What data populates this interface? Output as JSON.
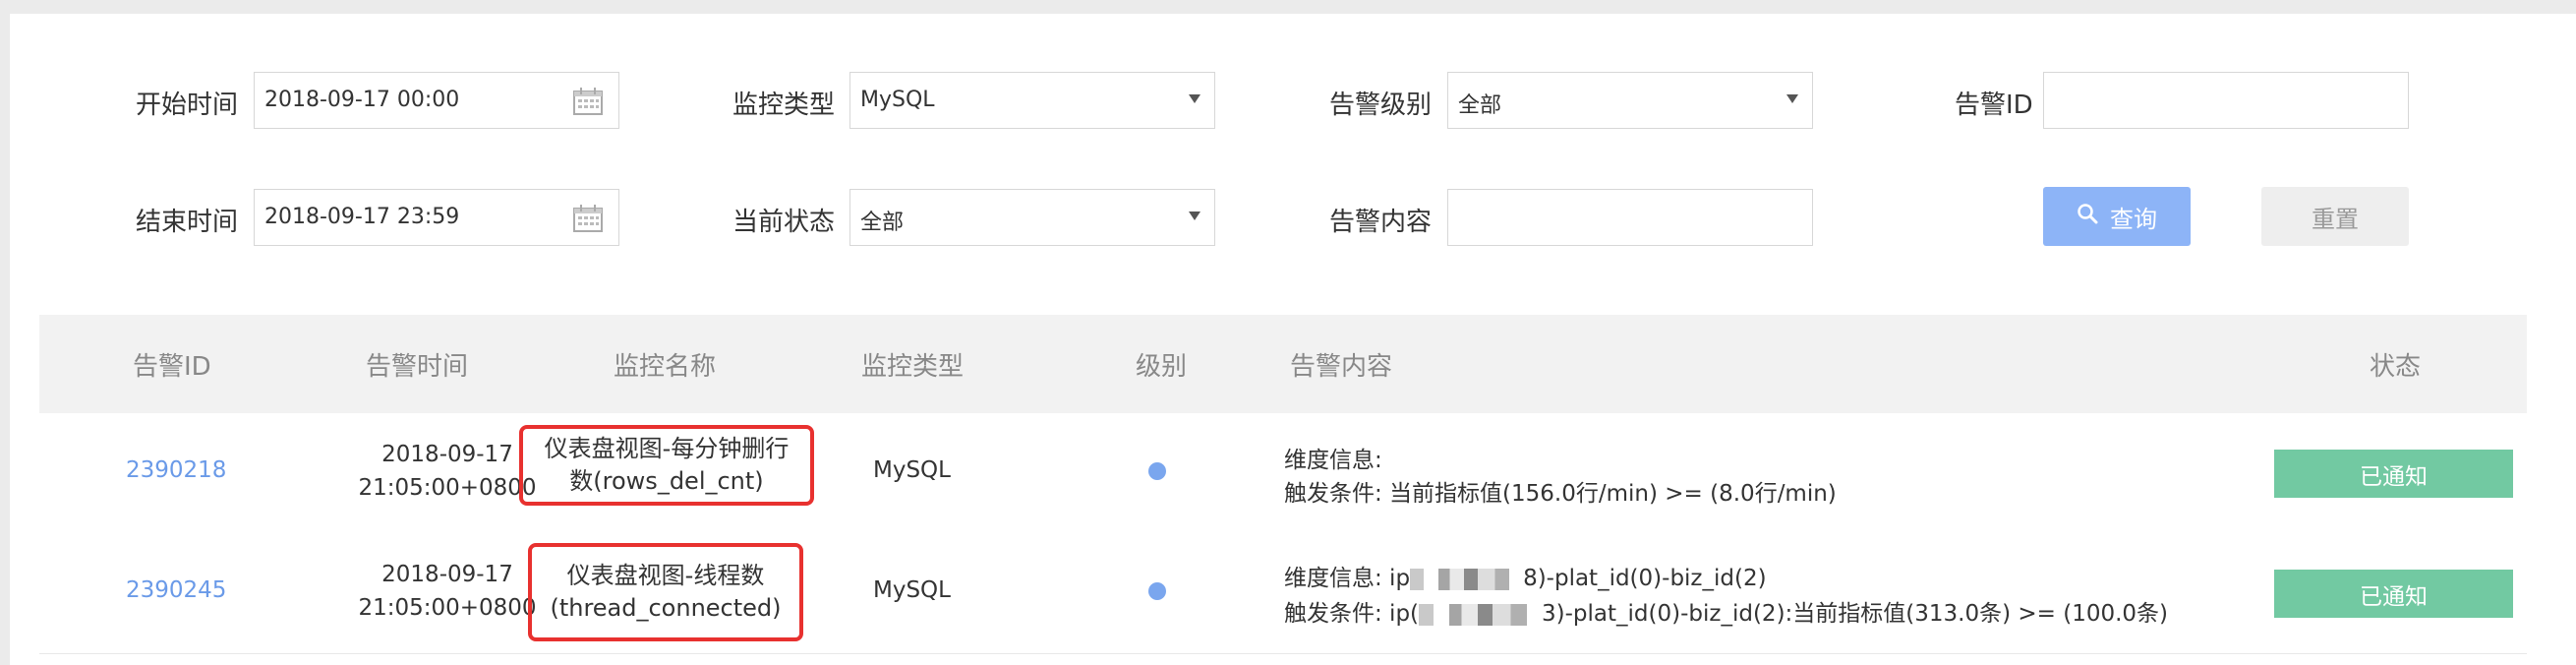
{
  "filters": {
    "start_time": {
      "label": "开始时间",
      "value": "2018-09-17 00:00"
    },
    "end_time": {
      "label": "结束时间",
      "value": "2018-09-17 23:59"
    },
    "monitor_type": {
      "label": "监控类型",
      "value": "MySQL"
    },
    "current_status": {
      "label": "当前状态",
      "value": "全部"
    },
    "alert_level": {
      "label": "告警级别",
      "value": "全部"
    },
    "alert_content": {
      "label": "告警内容",
      "value": ""
    },
    "alert_id": {
      "label": "告警ID",
      "value": ""
    },
    "query_button": "查询",
    "reset_button": "重置"
  },
  "table": {
    "headers": [
      "告警ID",
      "告警时间",
      "监控名称",
      "监控类型",
      "级别",
      "告警内容",
      "状态"
    ],
    "rows": [
      {
        "id": "2390218",
        "time_date": "2018-09-17",
        "time_clock": "21:05:00+0800",
        "name_line1": "仪表盘视图-每分钟删行",
        "name_line2": "数(rows_del_cnt)",
        "type": "MySQL",
        "content_line1": "维度信息:",
        "content_line2": "触发条件: 当前指标值(156.0行/min) >= (8.0行/min)",
        "status": "已通知"
      },
      {
        "id": "2390245",
        "time_date": "2018-09-17",
        "time_clock": "21:05:00+0800",
        "name_line1": "仪表盘视图-线程数",
        "name_line2": "(thread_connected)",
        "type": "MySQL",
        "content_line1_prefix": "维度信息: ip",
        "content_line1_suffix": "8)-plat_id(0)-biz_id(2)",
        "content_line2_prefix": "触发条件: ip(",
        "content_line2_suffix": "3)-plat_id(0)-biz_id(2):当前指标值(313.0条) >= (100.0条)",
        "status": "已通知"
      }
    ]
  },
  "colors": {
    "link": "#6a9ae8",
    "status_bg": "#72c9a2",
    "level_dot": "#7aa6ee",
    "highlight_border": "#e8312f",
    "query_button": "#8db4f7"
  }
}
